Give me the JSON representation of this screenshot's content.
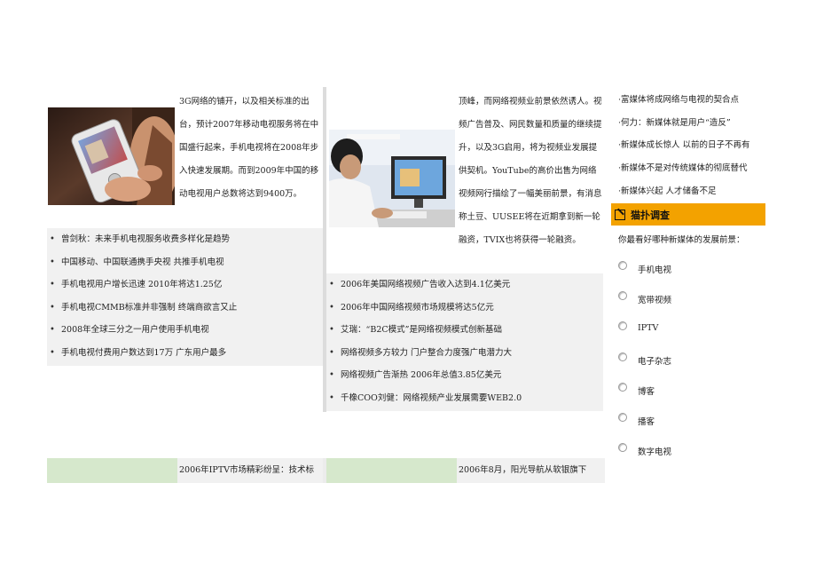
{
  "col1": {
    "paragraph": "3G网络的铺开，以及相关标准的出台，预计2007年移动电视服务将在中国盛行起来，手机电视将在2008年步入快速发展期。而到2009年中国的移动电视用户总数将达到9400万。",
    "links": [
      "曾剑秋：未来手机电视服务收费多样化是趋势",
      "中国移动、中国联通携手央视  共推手机电视",
      "手机电视用户增长迅速  2010年将达1.25亿",
      "手机电视CMMB标准并非强制  终端商欲言又止",
      "2008年全球三分之一用户使用手机电视",
      "手机电视付费用户数达到17万  广东用户最多"
    ],
    "bottom_text": "2006年IPTV市场精彩纷呈：技术标"
  },
  "col2": {
    "paragraph": "顶峰，而网络视频业前景依然诱人。视频广告普及、网民数量和质量的继续提升，以及3G启用，将为视频业发展提供契机。YouTube的高价出售为网络视频网行描绘了一幅美丽前景，有消息称土豆、UUSEE将在近期拿到新一轮融资，TVIX也将获得一轮融资。",
    "links": [
      "2006年美国网络视频广告收入达到4.1亿美元",
      "2006年中国网络视频市场规模将达5亿元",
      "艾瑞：“B2C模式”是网络视频模式创新基础",
      "网络视频多方较力  门户整合力度强广电潜力大",
      "网络视频广告渐热  2006年总值3.85亿美元",
      "千橡COO刘健：网络视频产业发展需要WEB2.0"
    ],
    "bottom_text": "2006年8月，阳光导航从软银旗下"
  },
  "sidebar": {
    "items": [
      "·富媒体将成网络与电视的契合点",
      "·何力：新媒体就是用户“造反”",
      "·新媒体成长惊人  以前的日子不再有",
      "·新媒体不是对传统媒体的彻底替代",
      "·新媒体兴起  人才储备不足"
    ],
    "survey": {
      "title": "猫扑调查",
      "question": "你最看好哪种新媒体的发展前景：",
      "options": [
        "手机电视",
        "宽带视频",
        "IPTV",
        "电子杂志",
        "博客",
        "播客",
        "数字电视"
      ]
    }
  },
  "colors": {
    "survey_header": "#f3a200",
    "list_background": "#f1f1f1",
    "bottom_green": "#d6e8cc",
    "separator": "#dcdcdc"
  }
}
